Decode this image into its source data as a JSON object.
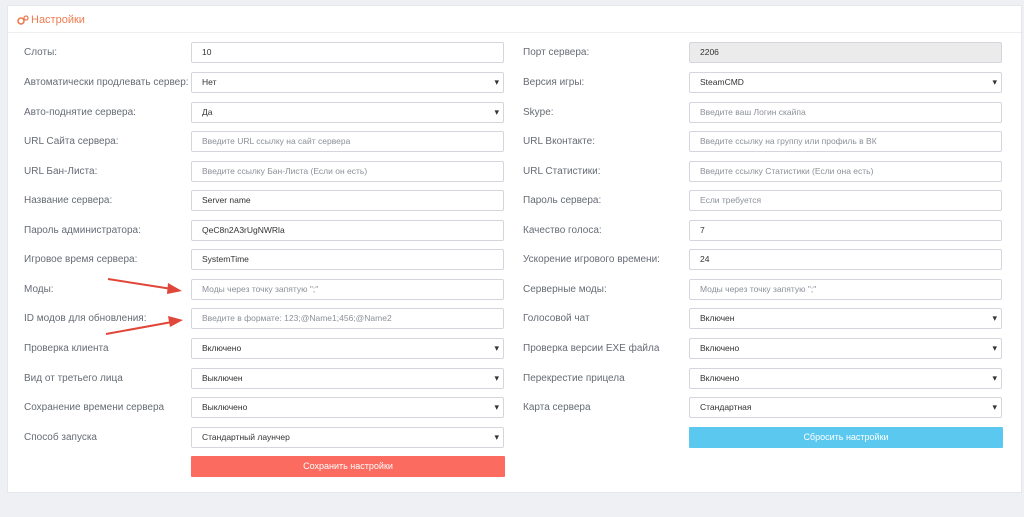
{
  "panel": {
    "title": "Настройки"
  },
  "left": [
    {
      "label": "Слоты:",
      "value": "10"
    },
    {
      "label": "Автоматически продлевать сервер:",
      "value": "Нет"
    },
    {
      "label": "Авто-поднятие сервера:",
      "value": "Да"
    },
    {
      "label": "URL Сайта сервера:",
      "placeholder": "Введите URL ссылку на сайт сервера"
    },
    {
      "label": "URL Бан-Листа:",
      "placeholder": "Введите ссылку Бан-Листа (Если он есть)"
    },
    {
      "label": "Название сервера:",
      "value": "Server name"
    },
    {
      "label": "Пароль администратора:",
      "value": "QeC8n2A3rUgNWRla"
    },
    {
      "label": "Игровое время сервера:",
      "value": "SystemTime"
    },
    {
      "label": "Моды:",
      "placeholder": "Моды через точку запятую \";\""
    },
    {
      "label": "ID модов для обновления:",
      "placeholder": "Введите в формате: 123;@Name1;456;@Name2"
    },
    {
      "label": "Проверка клиента",
      "value": "Включено"
    },
    {
      "label": "Вид от третьего лица",
      "value": "Выключен"
    },
    {
      "label": "Сохранение времени сервера",
      "value": "Выключено"
    },
    {
      "label": "Способ запуска",
      "value": "Стандартный лаунчер"
    }
  ],
  "right": [
    {
      "label": "Порт сервера:",
      "value": "2206"
    },
    {
      "label": "Версия игры:",
      "value": "SteamCMD"
    },
    {
      "label": "Skype:",
      "placeholder": "Введите ваш Логин скайпа"
    },
    {
      "label": "URL Вконтакте:",
      "placeholder": "Введите ссылку на группу или профиль в ВК"
    },
    {
      "label": "URL Статистики:",
      "placeholder": "Введите ссылку Статистики (Если она есть)"
    },
    {
      "label": "Пароль сервера:",
      "placeholder": "Если требуется"
    },
    {
      "label": "Качество голоса:",
      "value": "7"
    },
    {
      "label": "Ускорение игрового времени:",
      "value": "24"
    },
    {
      "label": "Серверные моды:",
      "placeholder": "Моды через точку запятую \";\""
    },
    {
      "label": "Голосовой чат",
      "value": "Включен"
    },
    {
      "label": "Проверка версии EXE файла",
      "value": "Включено"
    },
    {
      "label": "Перекрестие прицела",
      "value": "Включено"
    },
    {
      "label": "Карта сервера",
      "value": "Стандартная"
    }
  ],
  "buttons": {
    "save": "Сохранить настройки",
    "reset": "Сбросить настройки"
  },
  "colors": {
    "accent": "#ee7b4f",
    "save": "#fc6b5f",
    "reset": "#5bc8ef",
    "arrow": "#e0463a"
  }
}
